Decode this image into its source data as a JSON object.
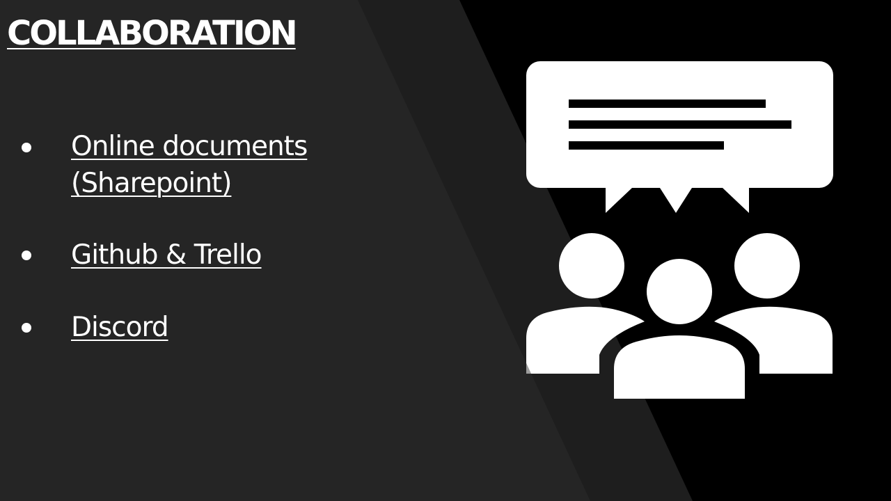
{
  "slide": {
    "title": "COLLABORATION",
    "bullets": [
      {
        "line1": "Online documents",
        "line2": "(Sharepoint)"
      },
      {
        "line1": "Github & Trello"
      },
      {
        "line1": "Discord"
      }
    ]
  },
  "icons": {
    "illustration": "team-chat-icon"
  },
  "colors": {
    "background_dark": "#262626",
    "background_mid": "#1e1e1e",
    "background_black": "#000000",
    "text": "#ffffff",
    "icon": "#ffffff"
  }
}
